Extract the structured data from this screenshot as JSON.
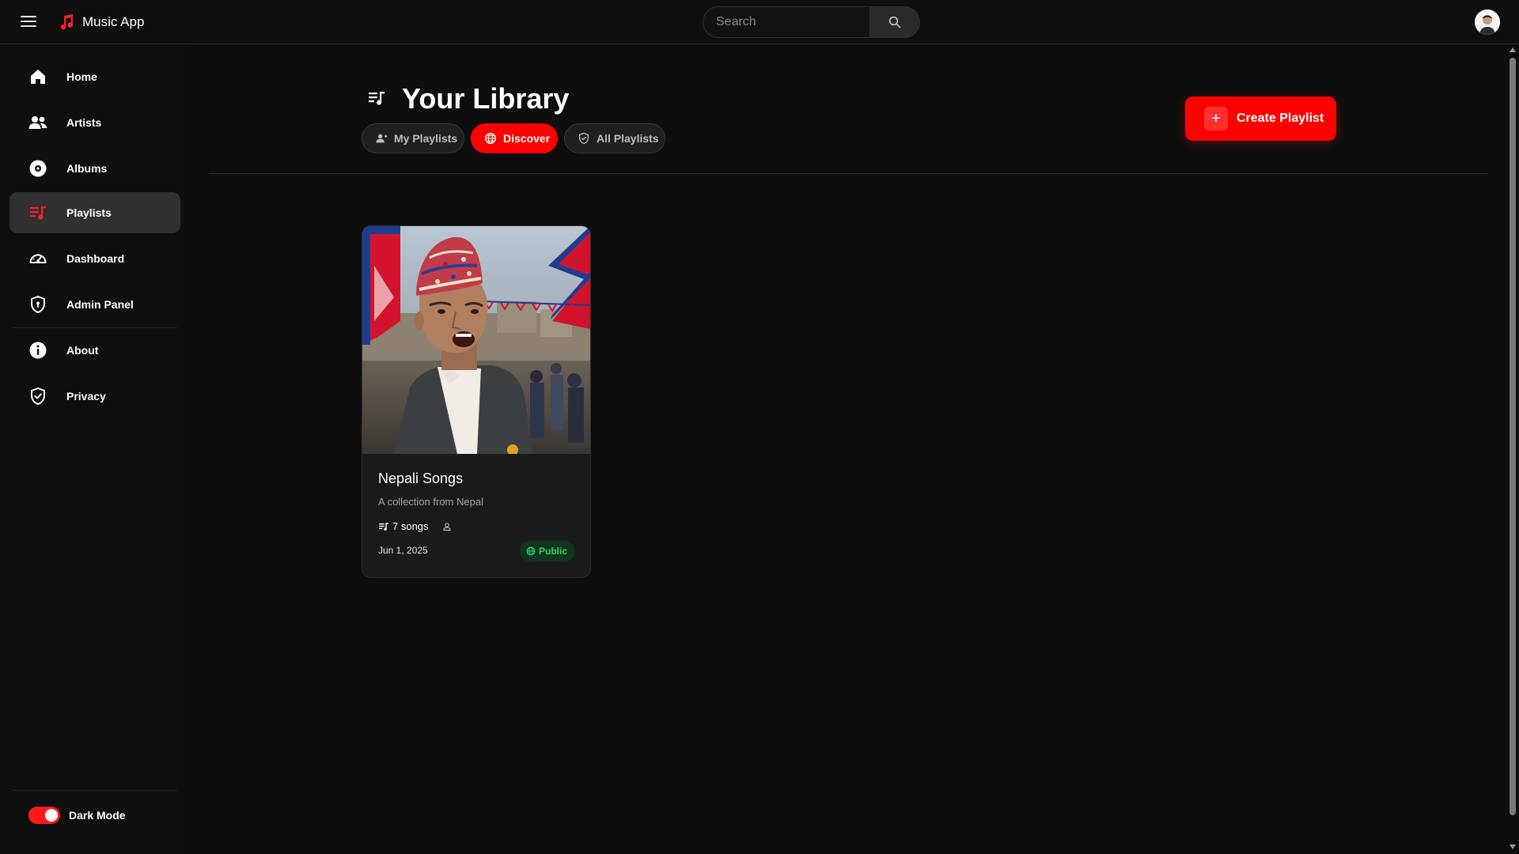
{
  "app": {
    "name": "Music App"
  },
  "search": {
    "placeholder": "Search"
  },
  "sidebar": {
    "items": [
      {
        "label": "Home",
        "icon": "home-icon"
      },
      {
        "label": "Artists",
        "icon": "people-icon"
      },
      {
        "label": "Albums",
        "icon": "disc-icon"
      },
      {
        "label": "Playlists",
        "icon": "playlist-icon",
        "active": true
      },
      {
        "label": "Dashboard",
        "icon": "gauge-icon"
      },
      {
        "label": "Admin Panel",
        "icon": "shield-icon"
      },
      {
        "label": "About",
        "icon": "info-icon"
      },
      {
        "label": "Privacy",
        "icon": "shield-check-icon"
      }
    ],
    "dark_mode": {
      "label": "Dark Mode",
      "enabled": true
    }
  },
  "main": {
    "title": "Your Library",
    "tabs": [
      {
        "label": "My Playlists",
        "icon": "user-icon"
      },
      {
        "label": "Discover",
        "icon": "globe-icon",
        "active": true
      },
      {
        "label": "All Playlists",
        "icon": "shield-icon"
      }
    ],
    "create_button": {
      "label": "Create Playlist",
      "icon": "plus-icon"
    },
    "playlists": [
      {
        "title": "Nepali Songs",
        "description": "A collection from Nepal",
        "songs": "7 songs",
        "date": "Jun 1, 2025",
        "visibility": "Public"
      }
    ]
  },
  "colors": {
    "accent": "#ff0000",
    "background": "#0e0e0e",
    "surface": "#1a1a1a",
    "badge_text": "#2ed46a",
    "badge_bg": "#11341f"
  }
}
